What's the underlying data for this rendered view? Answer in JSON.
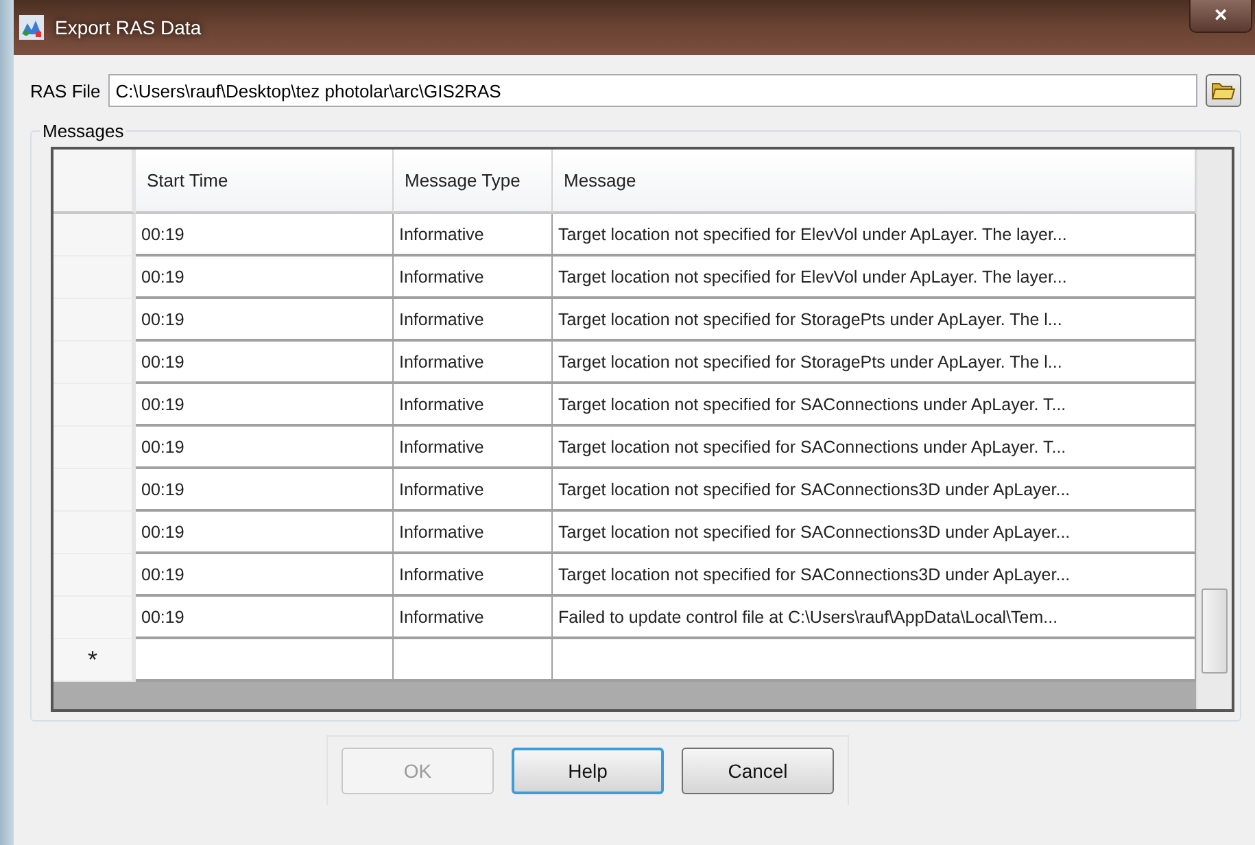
{
  "window": {
    "title": "Export RAS Data",
    "close": "×"
  },
  "ras_file": {
    "label": "RAS File",
    "value": "C:\\Users\\rauf\\Desktop\\tez photolar\\arc\\GIS2RAS"
  },
  "messages": {
    "title": "Messages",
    "columns": [
      "Start Time",
      "Message Type",
      "Message"
    ],
    "rows": [
      {
        "start_time": "00:19",
        "message_type": "Informative",
        "message": "Target location not specified for ElevVol under ApLayer. The layer..."
      },
      {
        "start_time": "00:19",
        "message_type": "Informative",
        "message": "Target location not specified for ElevVol under ApLayer. The layer..."
      },
      {
        "start_time": "00:19",
        "message_type": "Informative",
        "message": "Target location not specified for StoragePts under ApLayer. The l..."
      },
      {
        "start_time": "00:19",
        "message_type": "Informative",
        "message": "Target location not specified for StoragePts under ApLayer. The l..."
      },
      {
        "start_time": "00:19",
        "message_type": "Informative",
        "message": "Target location not specified for SAConnections under ApLayer. T..."
      },
      {
        "start_time": "00:19",
        "message_type": "Informative",
        "message": "Target location not specified for SAConnections under ApLayer. T..."
      },
      {
        "start_time": "00:19",
        "message_type": "Informative",
        "message": "Target location not specified for SAConnections3D under ApLayer..."
      },
      {
        "start_time": "00:19",
        "message_type": "Informative",
        "message": "Target location not specified for SAConnections3D under ApLayer..."
      },
      {
        "start_time": "00:19",
        "message_type": "Informative",
        "message": "Target location not specified for SAConnections3D under ApLayer..."
      },
      {
        "start_time": "00:19",
        "message_type": "Informative",
        "message": "Failed to update control file at C:\\Users\\rauf\\AppData\\Local\\Tem..."
      }
    ],
    "new_row_marker": "*"
  },
  "buttons": [
    {
      "label": "OK",
      "disabled": true,
      "focused": false
    },
    {
      "label": "Help",
      "disabled": false,
      "focused": true
    },
    {
      "label": "Cancel",
      "disabled": false,
      "focused": false
    }
  ]
}
